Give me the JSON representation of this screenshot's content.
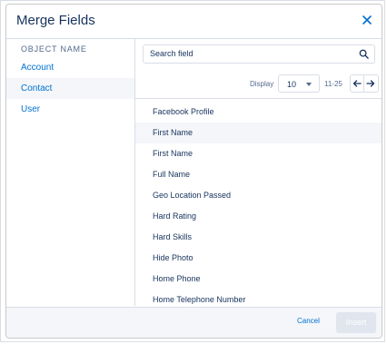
{
  "modal": {
    "title": "Merge Fields"
  },
  "objects": {
    "header": "OBJECT NAME",
    "items": [
      {
        "label": "Account"
      },
      {
        "label": "Contact"
      },
      {
        "label": "User"
      }
    ],
    "selected": "Contact"
  },
  "search": {
    "placeholder": "Search field"
  },
  "pagination": {
    "display_label": "Display",
    "page_size": "10",
    "range": "11-25"
  },
  "fields": [
    "Facebook Profile",
    "First Name",
    "First Name",
    "Full Name",
    "Geo Location Passed",
    "Hard Rating",
    "Hard Skills",
    "Hide Photo",
    "Home Phone",
    "Home Telephone Number"
  ],
  "footer": {
    "cancel_label": "Cancel",
    "insert_label": "Insert"
  },
  "icons": {
    "close": "close-icon",
    "search": "search-icon",
    "prev": "arrow-left-icon",
    "next": "arrow-right-icon",
    "caret": "chevron-down-icon"
  },
  "colors": {
    "link": "#0070d2",
    "text": "#16325c",
    "selected_bg": "#f4f6f9",
    "disabled_button": "#e0e5ee"
  }
}
